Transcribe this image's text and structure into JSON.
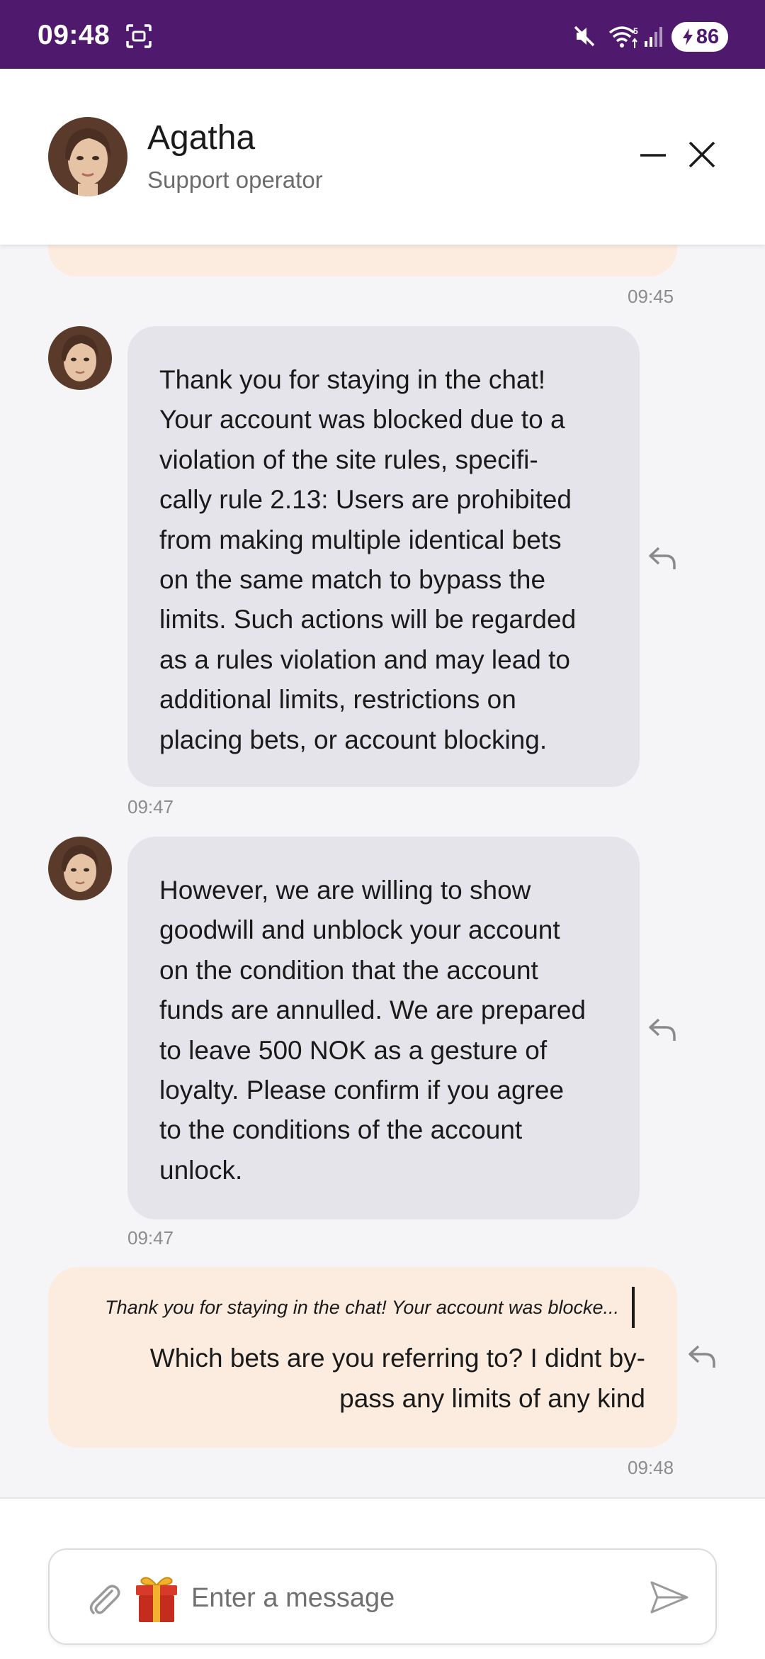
{
  "status_bar": {
    "time": "09:48",
    "battery_level": "86",
    "icons": [
      "screenshot-icon",
      "mute-icon",
      "wifi-icon",
      "signal-icon",
      "battery-charging-icon"
    ]
  },
  "header": {
    "agent_name": "Agatha",
    "agent_role": "Support operator",
    "icons": [
      "minimize-icon",
      "close-icon"
    ]
  },
  "messages": [
    {
      "direction": "out",
      "time": "09:45"
    },
    {
      "direction": "in",
      "lines": [
        "Thank you for staying in the chat!",
        "Your account was blocked due to a",
        "violation of the site rules, specifi-",
        "cally rule 2.13: Users are prohibited",
        "from making multiple identical bets",
        "on the same match to bypass the",
        "limits. Such actions will be regarded",
        "as a rules violation and may lead to",
        "additional limits, restrictions on",
        "placing bets, or account blocking."
      ],
      "time": "09:47"
    },
    {
      "direction": "in",
      "lines": [
        "However, we are willing to show",
        "goodwill and unblock your account",
        "on the condition that the account",
        "funds are annulled. We are prepared",
        "to leave 500 NOK as a gesture of",
        "loyalty. Please confirm if you agree",
        "to the conditions of the account",
        "unlock."
      ],
      "time": "09:47"
    },
    {
      "direction": "out",
      "quote": "Thank you for staying in the chat! Your account was blocke...",
      "lines": [
        "Which bets are you referring to? I didnt by-",
        "pass any limits of any kind"
      ],
      "time": "09:48"
    }
  ],
  "composer": {
    "placeholder": "Enter a message",
    "icons": [
      "paperclip-icon",
      "gift-icon",
      "send-icon"
    ]
  },
  "colors": {
    "status_bar": "#4f1a6e",
    "incoming_bubble": "#e4e4ea",
    "outgoing_bubble": "#fcece0",
    "background": "#f5f5f7"
  }
}
